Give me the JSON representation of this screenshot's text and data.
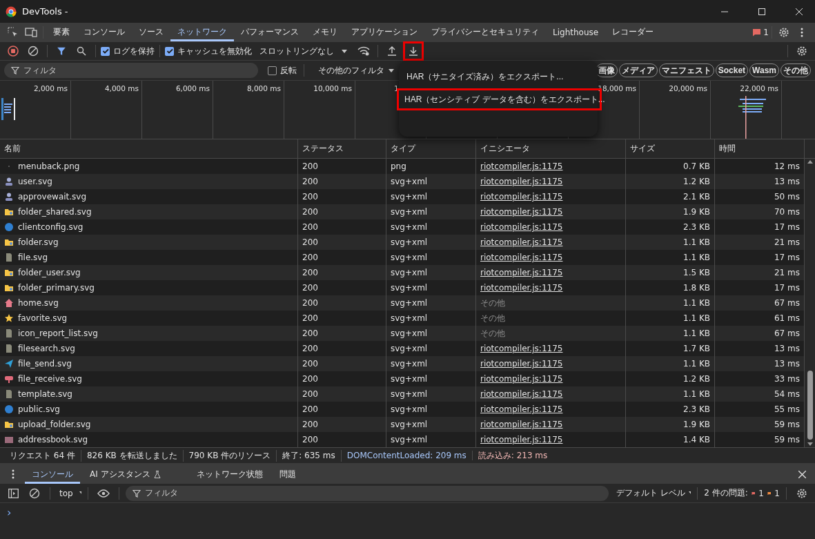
{
  "window": {
    "title": "DevTools -"
  },
  "main_tabs": [
    {
      "label": "要素",
      "selected": false
    },
    {
      "label": "コンソール",
      "selected": false
    },
    {
      "label": "ソース",
      "selected": false
    },
    {
      "label": "ネットワーク",
      "selected": true
    },
    {
      "label": "パフォーマンス",
      "selected": false
    },
    {
      "label": "メモリ",
      "selected": false
    },
    {
      "label": "アプリケーション",
      "selected": false
    },
    {
      "label": "プライバシーとセキュリティ",
      "selected": false
    },
    {
      "label": "Lighthouse",
      "selected": false
    },
    {
      "label": "レコーダー",
      "selected": false
    }
  ],
  "error_count": "1",
  "toolbar": {
    "recording": true,
    "preserve_log": {
      "label": "ログを保持",
      "checked": true
    },
    "disable_cache": {
      "label": "キャッシュを無効化",
      "checked": true
    },
    "throttling": "スロットリングなし",
    "download_highlighted": true
  },
  "filter_bar": {
    "placeholder": "フィルタ",
    "invert": {
      "label": "反転",
      "checked": false
    },
    "more_filters": "その他のフィルタ",
    "chips": [
      "画像",
      "メディア",
      "マニフェスト",
      "Socket",
      "Wasm",
      "その他"
    ]
  },
  "export_menu": {
    "items": [
      {
        "label": "HAR（サニタイズ済み）をエクスポート...",
        "highlighted": false
      },
      {
        "label": "HAR（センシティブ データを含む）をエクスポート...",
        "highlighted": true
      }
    ]
  },
  "timeline": {
    "ticks": [
      {
        "label": "2,000 ms"
      },
      {
        "label": "4,000 ms"
      },
      {
        "label": "6,000 ms"
      },
      {
        "label": "8,000 ms"
      },
      {
        "label": "10,000 ms"
      },
      {
        "label": "1",
        "cut": true
      },
      {
        "covered": true
      },
      {
        "covered": true
      },
      {
        "label": "18,000 ms"
      },
      {
        "label": "20,000 ms"
      },
      {
        "label": "22,000 ms"
      }
    ]
  },
  "table": {
    "columns": [
      "名前",
      "ステータス",
      "タイプ",
      "イニシエータ",
      "サイズ",
      "時間"
    ],
    "rows": [
      {
        "kind": "image",
        "name": "menuback.png",
        "status": "200",
        "type": "png",
        "initiator": "riotcompiler.js:1175",
        "link": true,
        "size": "0.7 KB",
        "time": "12 ms"
      },
      {
        "kind": "user",
        "name": "user.svg",
        "status": "200",
        "type": "svg+xml",
        "initiator": "riotcompiler.js:1175",
        "link": true,
        "size": "1.2 KB",
        "time": "13 ms"
      },
      {
        "kind": "user",
        "name": "approvewait.svg",
        "status": "200",
        "type": "svg+xml",
        "initiator": "riotcompiler.js:1175",
        "link": true,
        "size": "2.1 KB",
        "time": "50 ms"
      },
      {
        "kind": "folder",
        "name": "folder_shared.svg",
        "status": "200",
        "type": "svg+xml",
        "initiator": "riotcompiler.js:1175",
        "link": true,
        "size": "1.9 KB",
        "time": "70 ms"
      },
      {
        "kind": "globe",
        "name": "clientconfig.svg",
        "status": "200",
        "type": "svg+xml",
        "initiator": "riotcompiler.js:1175",
        "link": true,
        "size": "2.3 KB",
        "time": "17 ms"
      },
      {
        "kind": "folder",
        "name": "folder.svg",
        "status": "200",
        "type": "svg+xml",
        "initiator": "riotcompiler.js:1175",
        "link": true,
        "size": "1.1 KB",
        "time": "21 ms"
      },
      {
        "kind": "file",
        "name": "file.svg",
        "status": "200",
        "type": "svg+xml",
        "initiator": "riotcompiler.js:1175",
        "link": true,
        "size": "1.1 KB",
        "time": "17 ms"
      },
      {
        "kind": "folder",
        "name": "folder_user.svg",
        "status": "200",
        "type": "svg+xml",
        "initiator": "riotcompiler.js:1175",
        "link": true,
        "size": "1.5 KB",
        "time": "21 ms"
      },
      {
        "kind": "folder",
        "name": "folder_primary.svg",
        "status": "200",
        "type": "svg+xml",
        "initiator": "riotcompiler.js:1175",
        "link": true,
        "size": "1.8 KB",
        "time": "17 ms"
      },
      {
        "kind": "home",
        "name": "home.svg",
        "status": "200",
        "type": "svg+xml",
        "initiator": "その他",
        "link": false,
        "size": "1.1 KB",
        "time": "67 ms"
      },
      {
        "kind": "star",
        "name": "favorite.svg",
        "status": "200",
        "type": "svg+xml",
        "initiator": "その他",
        "link": false,
        "size": "1.1 KB",
        "time": "61 ms"
      },
      {
        "kind": "file",
        "name": "icon_report_list.svg",
        "status": "200",
        "type": "svg+xml",
        "initiator": "その他",
        "link": false,
        "size": "1.1 KB",
        "time": "67 ms"
      },
      {
        "kind": "file",
        "name": "filesearch.svg",
        "status": "200",
        "type": "svg+xml",
        "initiator": "riotcompiler.js:1175",
        "link": true,
        "size": "1.7 KB",
        "time": "13 ms"
      },
      {
        "kind": "send",
        "name": "file_send.svg",
        "status": "200",
        "type": "svg+xml",
        "initiator": "riotcompiler.js:1175",
        "link": true,
        "size": "1.1 KB",
        "time": "13 ms"
      },
      {
        "kind": "mailbox",
        "name": "file_receive.svg",
        "status": "200",
        "type": "svg+xml",
        "initiator": "riotcompiler.js:1175",
        "link": true,
        "size": "1.2 KB",
        "time": "33 ms"
      },
      {
        "kind": "file",
        "name": "template.svg",
        "status": "200",
        "type": "svg+xml",
        "initiator": "riotcompiler.js:1175",
        "link": true,
        "size": "1.1 KB",
        "time": "54 ms"
      },
      {
        "kind": "globe",
        "name": "public.svg",
        "status": "200",
        "type": "svg+xml",
        "initiator": "riotcompiler.js:1175",
        "link": true,
        "size": "2.3 KB",
        "time": "55 ms"
      },
      {
        "kind": "folder",
        "name": "upload_folder.svg",
        "status": "200",
        "type": "svg+xml",
        "initiator": "riotcompiler.js:1175",
        "link": true,
        "size": "1.9 KB",
        "time": "59 ms"
      },
      {
        "kind": "book",
        "name": "addressbook.svg",
        "status": "200",
        "type": "svg+xml",
        "initiator": "riotcompiler.js:1175",
        "link": true,
        "size": "1.4 KB",
        "time": "59 ms"
      }
    ]
  },
  "summary": [
    {
      "text": "リクエスト 64 件",
      "kind": "plain"
    },
    {
      "text": "826 KB を転送しました",
      "kind": "plain"
    },
    {
      "text": "790 KB 件のリソース",
      "kind": "plain"
    },
    {
      "text": "終了: 635 ms",
      "kind": "plain"
    },
    {
      "text": "DOMContentLoaded: 209 ms",
      "kind": "dom"
    },
    {
      "text": "読み込み: 213 ms",
      "kind": "load"
    }
  ],
  "drawer_tabs": [
    {
      "label": "コンソール",
      "selected": true
    },
    {
      "label": "AI アシスタンス",
      "selected": false,
      "lab": true
    },
    {
      "label": "ネットワーク状態",
      "selected": false
    },
    {
      "label": "問題",
      "selected": false
    }
  ],
  "console_toolbar": {
    "context": "top",
    "filter_placeholder": "フィルタ",
    "level": "デフォルト レベル",
    "issues_label": "2 件の問題:",
    "error_issues": "1",
    "warning_issues": "1"
  },
  "console_prompt": "›"
}
